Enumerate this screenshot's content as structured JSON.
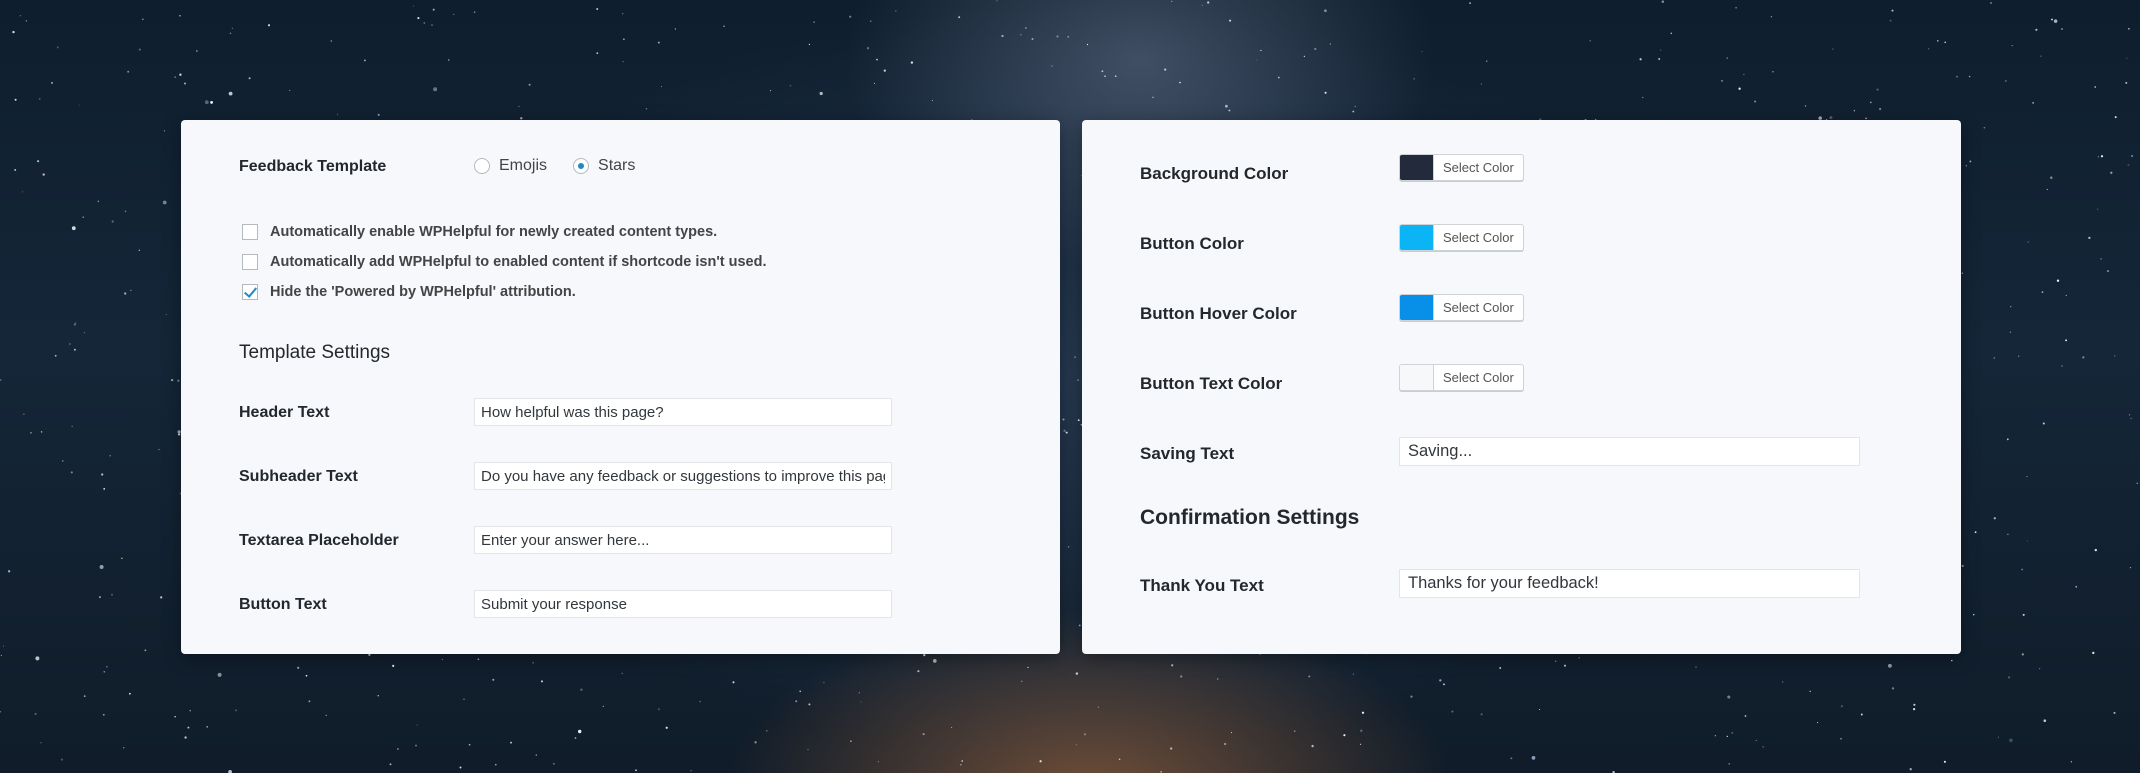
{
  "left_panel": {
    "feedback_template": {
      "label": "Feedback Template",
      "options": [
        {
          "label": "Emojis",
          "checked": false
        },
        {
          "label": "Stars",
          "checked": true
        }
      ]
    },
    "checkboxes": [
      {
        "label": "Automatically enable WPHelpful for newly created content types.",
        "checked": false
      },
      {
        "label": "Automatically add WPHelpful to enabled content if shortcode isn't used.",
        "checked": false
      },
      {
        "label": "Hide the 'Powered by WPHelpful' attribution.",
        "checked": true
      }
    ],
    "template_settings_title": "Template Settings",
    "fields": [
      {
        "label": "Header Text",
        "value": "How helpful was this page?"
      },
      {
        "label": "Subheader Text",
        "value": "Do you have any feedback or suggestions to improve this page?"
      },
      {
        "label": "Textarea Placeholder",
        "value": "Enter your answer here..."
      },
      {
        "label": "Button Text",
        "value": "Submit your response"
      }
    ]
  },
  "right_panel": {
    "colors": [
      {
        "label": "Background Color",
        "button_label": "Select Color",
        "color": "#232a3b"
      },
      {
        "label": "Button Color",
        "button_label": "Select Color",
        "color": "#0ab4f5"
      },
      {
        "label": "Button Hover Color",
        "button_label": "Select Color",
        "color": "#0890e8"
      },
      {
        "label": "Button Text Color",
        "button_label": "Select Color",
        "color": "#f7f8fa"
      }
    ],
    "saving_text": {
      "label": "Saving Text",
      "value": "Saving..."
    },
    "confirmation_settings_title": "Confirmation Settings",
    "thank_you_text": {
      "label": "Thank You Text",
      "value": "Thanks for your feedback!"
    }
  }
}
